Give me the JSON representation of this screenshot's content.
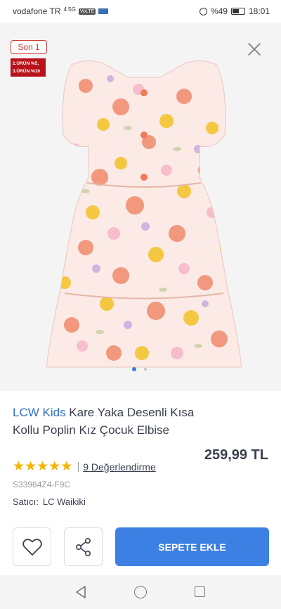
{
  "status_bar": {
    "carrier": "vodafone TR",
    "net_badge": "VoLTE",
    "signal": "4.5G",
    "battery": "%49",
    "time": "18:01",
    "icons": [
      "mini-app-icon",
      "alarm-icon",
      "battery-icon"
    ]
  },
  "hero": {
    "stock_badge": "Son 1",
    "promo_lines": [
      "2.ÜRÜN %5,",
      "3.ÜRÜN %10"
    ],
    "close_icon": "close-icon",
    "image_alt": "dress-image",
    "pager": {
      "count": 2,
      "active": 1
    }
  },
  "product": {
    "brand": "LCW Kids",
    "name": " Kare Yaka Desenli Kısa Kollu Poplin Kız Çocuk Elbise",
    "price": "259,99 TL",
    "rating": 5,
    "reviews": "9 Değerlendirme",
    "sku": "S33984Z4-F9C",
    "seller_label": "Satıcı:",
    "seller_name": "LC Waikiki"
  },
  "actions": {
    "favorite_icon": "heart-icon",
    "share_icon": "share-icon",
    "cart_label": "SEPETE EKLE"
  },
  "nav": {
    "icons": [
      "back-triangle-icon",
      "home-circle-icon",
      "recent-square-icon"
    ]
  },
  "colors": {
    "brand_blue": "#2f72c4",
    "button_blue": "#3d80e3",
    "star": "#f4b400",
    "badge_red": "#b8131a"
  }
}
